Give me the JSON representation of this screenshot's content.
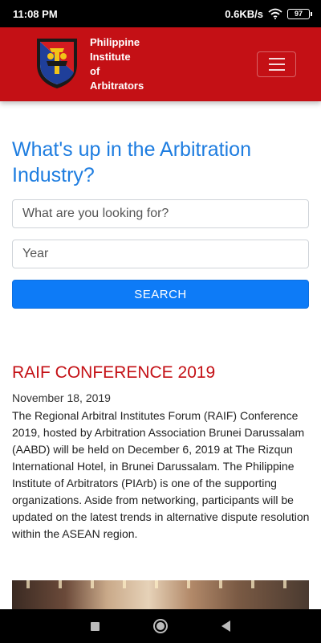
{
  "status_bar": {
    "time": "11:08 PM",
    "network_speed": "0.6KB/s",
    "battery": "97"
  },
  "header": {
    "brand_lines": [
      "Philippine",
      "Institute",
      "of",
      "Arbitrators"
    ],
    "menu_icon": "hamburger-menu-icon",
    "background_color": "#c41015"
  },
  "search_section": {
    "headline": "What's up in the Arbitration Industry?",
    "search_placeholder": "What are you looking for?",
    "year_placeholder": "Year",
    "search_button_label": "SEARCH",
    "accent_color": "#1e7de0"
  },
  "article": {
    "title": "RAIF CONFERENCE 2019",
    "date": "November 18, 2019",
    "body": "The Regional Arbitral Institutes Forum (RAIF) Conference 2019, hosted by Arbitration Association Brunei Darussalam (AABD) will be held on December 6, 2019 at The Rizqun International Hotel, in Brunei Darussalam. The Philippine Institute of Arbitrators (PIArb) is one of the supporting organizations. Aside from networking, participants will be updated on the latest trends in alternative dispute resolution within the ASEAN region."
  },
  "nav_bar": {
    "buttons": [
      "recent-apps-icon",
      "home-icon",
      "back-icon"
    ]
  }
}
